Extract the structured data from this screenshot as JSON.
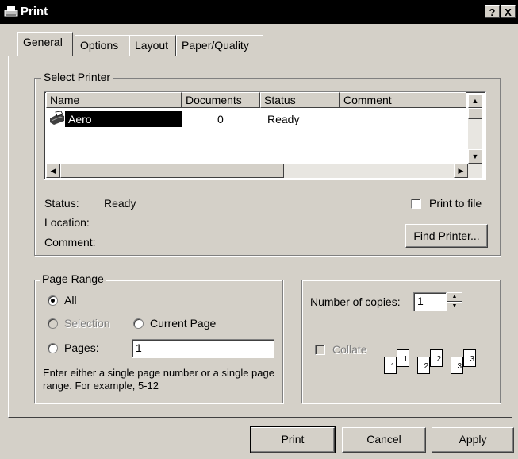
{
  "window": {
    "title": "Print",
    "help_label": "?",
    "close_label": "X"
  },
  "tabs": [
    "General",
    "Options",
    "Layout",
    "Paper/Quality"
  ],
  "select_printer": {
    "legend": "Select Printer",
    "columns": [
      "Name",
      "Documents",
      "Status",
      "Comment"
    ],
    "rows": [
      {
        "name": "Aero",
        "documents": "0",
        "status": "Ready",
        "comment": ""
      }
    ],
    "status_label": "Status:",
    "status_value": "Ready",
    "location_label": "Location:",
    "comment_label": "Comment:",
    "print_to_file_label": "Print to file",
    "find_printer_label": "Find Printer..."
  },
  "page_range": {
    "legend": "Page Range",
    "all_label": "All",
    "selection_label": "Selection",
    "current_page_label": "Current Page",
    "pages_label": "Pages:",
    "pages_value": "1",
    "hint": "Enter either a single page number or a single page range.  For example, 5-12"
  },
  "copies": {
    "number_label": "Number of copies:",
    "number_value": "1",
    "collate_label": "Collate",
    "collate_pages": [
      "1",
      "1",
      "2",
      "2",
      "3",
      "3"
    ]
  },
  "footer": {
    "print_label": "Print",
    "cancel_label": "Cancel",
    "apply_label": "Apply"
  }
}
